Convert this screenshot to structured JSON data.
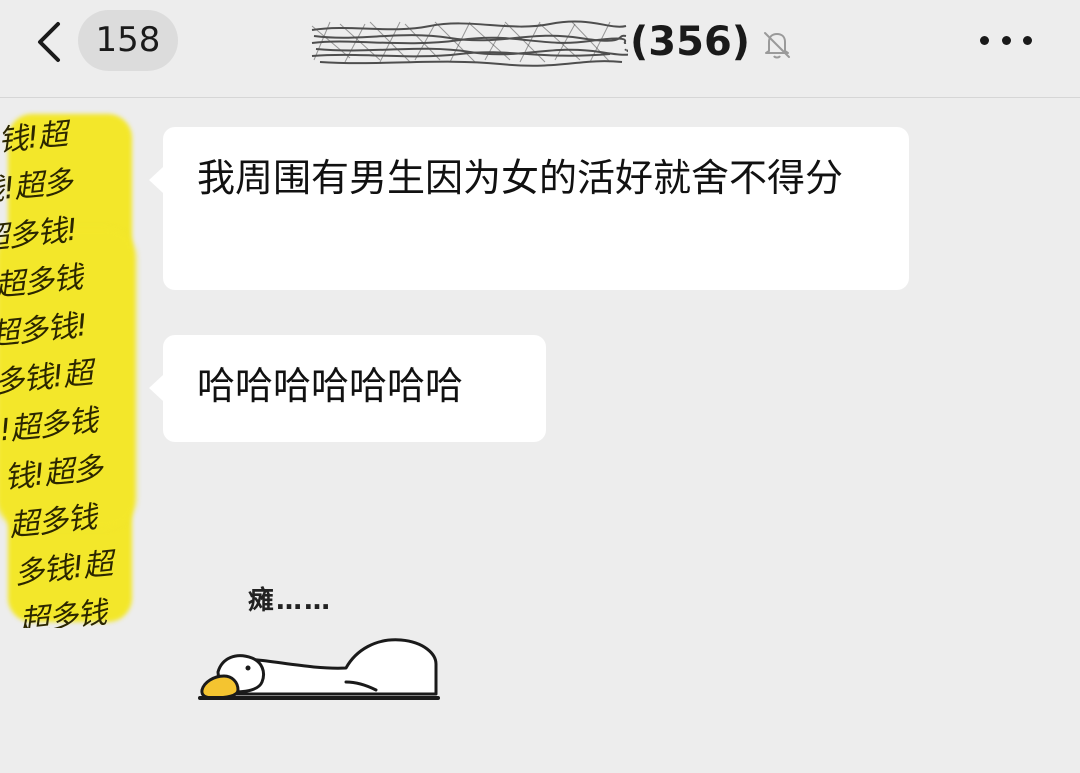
{
  "header": {
    "unread_count": "158",
    "member_count": "(356)",
    "icons": {
      "back": "chevron-left-icon",
      "mute": "bell-slash-icon",
      "more": "more-dots-icon"
    }
  },
  "messages": [
    {
      "text": "我周围有男生因为女的活好就舍不得分"
    },
    {
      "text": "哈哈哈哈哈哈哈"
    }
  ],
  "avatar_pattern": [
    "多钱!超",
    "钱!超多",
    "超多钱!",
    "!超多钱",
    "超多钱!",
    "多钱!超",
    "!超多钱",
    "钱!超多",
    "超多钱",
    "多钱!超",
    "超多钱"
  ],
  "sticker": {
    "caption": "瘫……",
    "icon": "goose-lying-flat-icon"
  },
  "colors": {
    "background": "#ededed",
    "bubble": "#ffffff",
    "avatar_yellow": "#f3e72a",
    "beak": "#f4c430"
  }
}
